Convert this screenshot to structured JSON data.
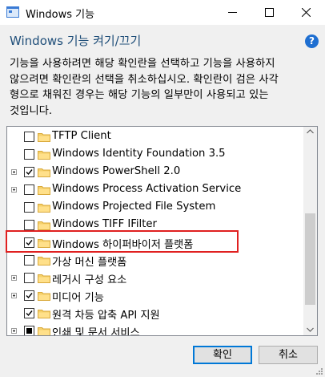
{
  "window": {
    "title": "Windows 기능"
  },
  "heading": "Windows 기능 켜기/끄기",
  "description": "기능을 사용하려면 해당 확인란을 선택하고 기능을 사용하지\n않으려면 확인란의 선택을 취소하십시오. 확인란이 검은 사각\n형으로 채워진 경우는 해당 기능의 일부만이 사용되고 있는\n것입니다.",
  "features": [
    {
      "label": "TFTP Client",
      "state": "unchecked",
      "expandable": false
    },
    {
      "label": "Windows Identity Foundation 3.5",
      "state": "unchecked",
      "expandable": false
    },
    {
      "label": "Windows PowerShell 2.0",
      "state": "checked",
      "expandable": true
    },
    {
      "label": "Windows Process Activation Service",
      "state": "unchecked",
      "expandable": true
    },
    {
      "label": "Windows Projected File System",
      "state": "unchecked",
      "expandable": false
    },
    {
      "label": "Windows TIFF IFilter",
      "state": "unchecked",
      "expandable": false
    },
    {
      "label": "Windows 하이퍼바이저 플랫폼",
      "state": "checked",
      "expandable": false
    },
    {
      "label": "가상 머신 플랫폼",
      "state": "unchecked",
      "expandable": false
    },
    {
      "label": "레거시 구성 요소",
      "state": "unchecked",
      "expandable": true
    },
    {
      "label": "미디어 기능",
      "state": "checked",
      "expandable": true
    },
    {
      "label": "원격 차등 압축 API 지원",
      "state": "checked",
      "expandable": false
    },
    {
      "label": "인쇄 및 문서 서비스",
      "state": "partial",
      "expandable": true
    }
  ],
  "buttons": {
    "ok": "확인",
    "cancel": "취소"
  },
  "colors": {
    "heading": "#1f4e79",
    "help": "#1f6fd1",
    "highlight": "#e02020",
    "folder": "#f5d06a"
  }
}
